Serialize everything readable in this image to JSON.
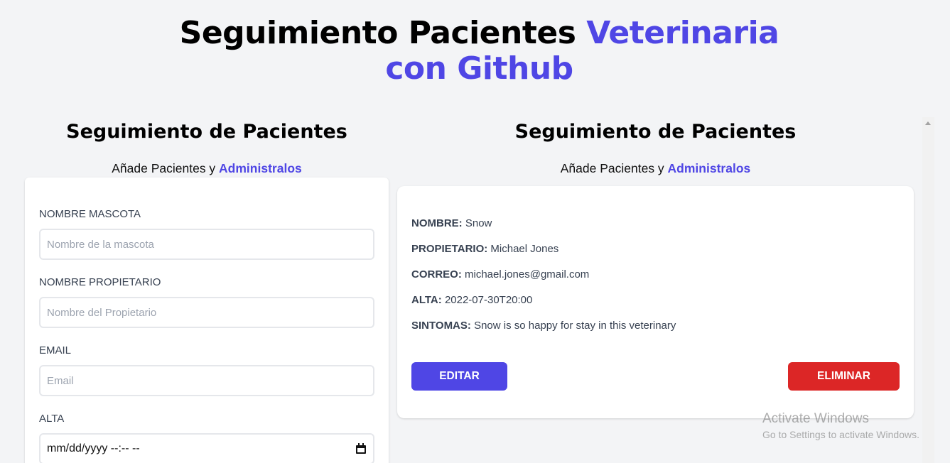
{
  "header": {
    "title_part1": "Seguimiento Pacientes ",
    "title_part2": "Veterinaria",
    "title_part3": "con Github"
  },
  "form_section": {
    "title": "Seguimiento de Pacientes",
    "subtitle_text": "Añade Pacientes y ",
    "subtitle_accent": "Administralos",
    "fields": [
      {
        "label": "Nombre Mascota",
        "placeholder": "Nombre de la mascota",
        "value": ""
      },
      {
        "label": "Nombre Propietario",
        "placeholder": "Nombre del Propietario",
        "value": ""
      },
      {
        "label": "Email",
        "placeholder": "Email",
        "value": ""
      },
      {
        "label": "Alta",
        "value": "mm/dd/yyyy --:-- --"
      }
    ]
  },
  "list_section": {
    "title": "Seguimiento de Pacientes",
    "subtitle_text": "Añade Pacientes y ",
    "subtitle_accent": "Administralos",
    "patient": {
      "nombre_label": "Nombre:",
      "nombre": "Snow",
      "propietario_label": "Propietario:",
      "propietario": "Michael Jones",
      "correo_label": "Correo:",
      "correo": "michael.jones@gmail.com",
      "alta_label": "Alta:",
      "alta": "2022-07-30T20:00",
      "sintomas_label": "Sintomas:",
      "sintomas": "Snow is so happy for stay in this veterinary"
    },
    "edit_label": "Editar",
    "delete_label": "Eliminar"
  },
  "watermark": {
    "line1": "Activate Windows",
    "line2": "Go to Settings to activate Windows."
  },
  "colors": {
    "accent": "#4f46e5",
    "danger": "#dc2626",
    "background": "#f3f4f6"
  }
}
